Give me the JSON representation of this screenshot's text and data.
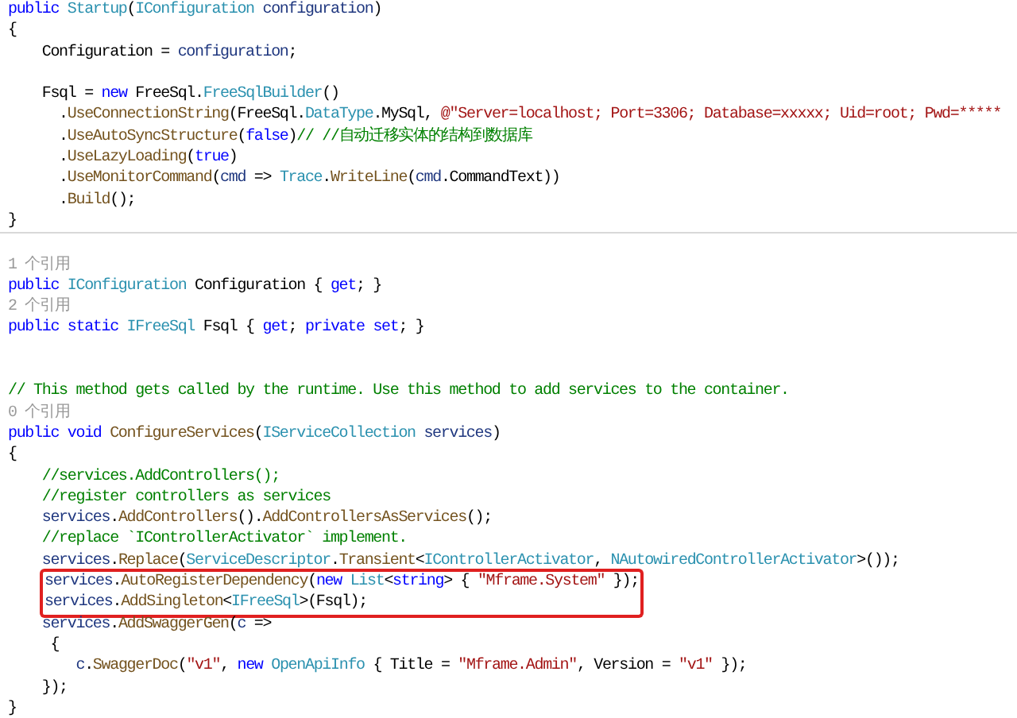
{
  "editor": {
    "sections": [
      {
        "lines": [
          {
            "kind": "code",
            "highlighted": false,
            "tokens": [
              {
                "kind": "kw",
                "t": "public "
              },
              {
                "kind": "type",
                "t": "Startup"
              },
              {
                "kind": "p",
                "t": "("
              },
              {
                "kind": "type",
                "t": "IConfiguration"
              },
              {
                "kind": "param",
                "t": " configuration"
              },
              {
                "kind": "p",
                "t": ")"
              }
            ]
          },
          {
            "kind": "code",
            "highlighted": false,
            "tokens": [
              {
                "kind": "p",
                "t": "{"
              }
            ]
          },
          {
            "kind": "code",
            "highlighted": false,
            "tokens": [
              {
                "kind": "p",
                "t": "    Configuration = "
              },
              {
                "kind": "param",
                "t": "configuration"
              },
              {
                "kind": "p",
                "t": ";"
              }
            ]
          },
          {
            "kind": "blank"
          },
          {
            "kind": "code",
            "highlighted": false,
            "tokens": [
              {
                "kind": "p",
                "t": "    Fsql = "
              },
              {
                "kind": "kw",
                "t": "new "
              },
              {
                "kind": "p",
                "t": "FreeSql."
              },
              {
                "kind": "type",
                "t": "FreeSqlBuilder"
              },
              {
                "kind": "p",
                "t": "()"
              }
            ]
          },
          {
            "kind": "code",
            "highlighted": false,
            "tokens": [
              {
                "kind": "p",
                "t": "      ."
              },
              {
                "kind": "method",
                "t": "UseConnectionString"
              },
              {
                "kind": "p",
                "t": "(FreeSql."
              },
              {
                "kind": "type",
                "t": "DataType"
              },
              {
                "kind": "p",
                "t": ".MySql, "
              },
              {
                "kind": "str",
                "t": "@\"Server=localhost; Port=3306; Database=xxxxx; Uid=root; Pwd=*****"
              }
            ]
          },
          {
            "kind": "code",
            "highlighted": false,
            "tokens": [
              {
                "kind": "p",
                "t": "      ."
              },
              {
                "kind": "method",
                "t": "UseAutoSyncStructure"
              },
              {
                "kind": "p",
                "t": "("
              },
              {
                "kind": "kw",
                "t": "false"
              },
              {
                "kind": "p",
                "t": ")"
              },
              {
                "kind": "com",
                "t": "// //自动迁移实体的结构到数据库"
              }
            ]
          },
          {
            "kind": "code",
            "highlighted": false,
            "tokens": [
              {
                "kind": "p",
                "t": "      ."
              },
              {
                "kind": "method",
                "t": "UseLazyLoading"
              },
              {
                "kind": "p",
                "t": "("
              },
              {
                "kind": "kw",
                "t": "true"
              },
              {
                "kind": "p",
                "t": ")"
              }
            ]
          },
          {
            "kind": "code",
            "highlighted": false,
            "tokens": [
              {
                "kind": "p",
                "t": "      ."
              },
              {
                "kind": "method",
                "t": "UseMonitorCommand"
              },
              {
                "kind": "p",
                "t": "("
              },
              {
                "kind": "param",
                "t": "cmd"
              },
              {
                "kind": "p",
                "t": " => "
              },
              {
                "kind": "type",
                "t": "Trace"
              },
              {
                "kind": "p",
                "t": "."
              },
              {
                "kind": "method",
                "t": "WriteLine"
              },
              {
                "kind": "p",
                "t": "("
              },
              {
                "kind": "param",
                "t": "cmd"
              },
              {
                "kind": "p",
                "t": ".CommandText))"
              }
            ]
          },
          {
            "kind": "code",
            "highlighted": false,
            "tokens": [
              {
                "kind": "p",
                "t": "      ."
              },
              {
                "kind": "method",
                "t": "Build"
              },
              {
                "kind": "p",
                "t": "();"
              }
            ]
          },
          {
            "kind": "code",
            "highlighted": false,
            "tokens": [
              {
                "kind": "p",
                "t": "}"
              }
            ]
          }
        ]
      },
      {
        "lines": [
          {
            "kind": "blank"
          },
          {
            "kind": "lens",
            "highlighted": false,
            "tokens": [
              {
                "kind": "lens",
                "t": "1 个引用"
              }
            ]
          },
          {
            "kind": "code",
            "highlighted": false,
            "tokens": [
              {
                "kind": "kw",
                "t": "public "
              },
              {
                "kind": "type",
                "t": "IConfiguration"
              },
              {
                "kind": "p",
                "t": " Configuration { "
              },
              {
                "kind": "kw",
                "t": "get"
              },
              {
                "kind": "p",
                "t": "; }"
              }
            ]
          },
          {
            "kind": "lens",
            "highlighted": false,
            "tokens": [
              {
                "kind": "lens",
                "t": "2 个引用"
              }
            ]
          },
          {
            "kind": "code",
            "highlighted": false,
            "tokens": [
              {
                "kind": "kw",
                "t": "public static "
              },
              {
                "kind": "type",
                "t": "IFreeSql"
              },
              {
                "kind": "p",
                "t": " Fsql { "
              },
              {
                "kind": "kw",
                "t": "get"
              },
              {
                "kind": "p",
                "t": "; "
              },
              {
                "kind": "kw",
                "t": "private set"
              },
              {
                "kind": "p",
                "t": "; }"
              }
            ]
          },
          {
            "kind": "blank"
          },
          {
            "kind": "blank"
          },
          {
            "kind": "code",
            "highlighted": false,
            "tokens": [
              {
                "kind": "com",
                "t": "// This method gets called by the runtime. Use this method to add services to the container."
              }
            ]
          },
          {
            "kind": "lens",
            "highlighted": false,
            "tokens": [
              {
                "kind": "lens",
                "t": "0 个引用"
              }
            ]
          },
          {
            "kind": "code",
            "highlighted": false,
            "tokens": [
              {
                "kind": "kw",
                "t": "public void "
              },
              {
                "kind": "method",
                "t": "ConfigureServices"
              },
              {
                "kind": "p",
                "t": "("
              },
              {
                "kind": "type",
                "t": "IServiceCollection"
              },
              {
                "kind": "param",
                "t": " services"
              },
              {
                "kind": "p",
                "t": ")"
              }
            ]
          },
          {
            "kind": "code",
            "highlighted": false,
            "tokens": [
              {
                "kind": "p",
                "t": "{"
              }
            ]
          },
          {
            "kind": "code",
            "highlighted": false,
            "tokens": [
              {
                "kind": "com",
                "t": "    //services.AddControllers();"
              }
            ]
          },
          {
            "kind": "code",
            "highlighted": false,
            "tokens": [
              {
                "kind": "com",
                "t": "    //register controllers as services"
              }
            ]
          },
          {
            "kind": "code",
            "highlighted": false,
            "tokens": [
              {
                "kind": "param",
                "t": "    services"
              },
              {
                "kind": "p",
                "t": "."
              },
              {
                "kind": "method",
                "t": "AddControllers"
              },
              {
                "kind": "p",
                "t": "()."
              },
              {
                "kind": "method",
                "t": "AddControllersAsServices"
              },
              {
                "kind": "p",
                "t": "();"
              }
            ]
          },
          {
            "kind": "code",
            "highlighted": false,
            "tokens": [
              {
                "kind": "com",
                "t": "    //replace `IControllerActivator` implement."
              }
            ]
          },
          {
            "kind": "code",
            "highlighted": false,
            "tokens": [
              {
                "kind": "param",
                "t": "    services"
              },
              {
                "kind": "p",
                "t": "."
              },
              {
                "kind": "method",
                "t": "Replace"
              },
              {
                "kind": "p",
                "t": "("
              },
              {
                "kind": "type",
                "t": "ServiceDescriptor"
              },
              {
                "kind": "p",
                "t": "."
              },
              {
                "kind": "method",
                "t": "Transient"
              },
              {
                "kind": "p",
                "t": "<"
              },
              {
                "kind": "type",
                "t": "IControllerActivator"
              },
              {
                "kind": "p",
                "t": ", "
              },
              {
                "kind": "type",
                "t": "NAutowiredControllerActivator"
              },
              {
                "kind": "p",
                "t": ">());"
              }
            ]
          },
          {
            "kind": "code",
            "highlighted": true,
            "tokens": [
              {
                "kind": "param",
                "t": "services"
              },
              {
                "kind": "p",
                "t": "."
              },
              {
                "kind": "method",
                "t": "AutoRegisterDependency"
              },
              {
                "kind": "p",
                "t": "("
              },
              {
                "kind": "kw",
                "t": "new "
              },
              {
                "kind": "type",
                "t": "List"
              },
              {
                "kind": "p",
                "t": "<"
              },
              {
                "kind": "kw",
                "t": "string"
              },
              {
                "kind": "p",
                "t": "> { "
              },
              {
                "kind": "str",
                "t": "\"Mframe.System\""
              },
              {
                "kind": "p",
                "t": " });"
              }
            ]
          },
          {
            "kind": "code",
            "highlighted": true,
            "tokens": [
              {
                "kind": "param",
                "t": "services"
              },
              {
                "kind": "p",
                "t": "."
              },
              {
                "kind": "method",
                "t": "AddSingleton"
              },
              {
                "kind": "p",
                "t": "<"
              },
              {
                "kind": "type",
                "t": "IFreeSql"
              },
              {
                "kind": "p",
                "t": ">(Fsql);"
              }
            ]
          },
          {
            "kind": "code",
            "highlighted": false,
            "tokens": [
              {
                "kind": "param",
                "t": "    services"
              },
              {
                "kind": "p",
                "t": "."
              },
              {
                "kind": "method",
                "t": "AddSwaggerGen"
              },
              {
                "kind": "p",
                "t": "("
              },
              {
                "kind": "param",
                "t": "c"
              },
              {
                "kind": "p",
                "t": " =>"
              }
            ]
          },
          {
            "kind": "code",
            "highlighted": false,
            "tokens": [
              {
                "kind": "p",
                "t": "     {"
              }
            ]
          },
          {
            "kind": "code",
            "highlighted": false,
            "tokens": [
              {
                "kind": "param",
                "t": "        c"
              },
              {
                "kind": "p",
                "t": "."
              },
              {
                "kind": "method",
                "t": "SwaggerDoc"
              },
              {
                "kind": "p",
                "t": "("
              },
              {
                "kind": "str",
                "t": "\"v1\""
              },
              {
                "kind": "p",
                "t": ", "
              },
              {
                "kind": "kw",
                "t": "new "
              },
              {
                "kind": "type",
                "t": "OpenApiInfo"
              },
              {
                "kind": "p",
                "t": " { Title = "
              },
              {
                "kind": "str",
                "t": "\"Mframe.Admin\""
              },
              {
                "kind": "p",
                "t": ", Version = "
              },
              {
                "kind": "str",
                "t": "\"v1\""
              },
              {
                "kind": "p",
                "t": " });"
              }
            ]
          },
          {
            "kind": "code",
            "highlighted": false,
            "tokens": [
              {
                "kind": "p",
                "t": "    });"
              }
            ]
          },
          {
            "kind": "code",
            "highlighted": false,
            "tokens": [
              {
                "kind": "p",
                "t": "}"
              }
            ]
          }
        ]
      }
    ]
  }
}
